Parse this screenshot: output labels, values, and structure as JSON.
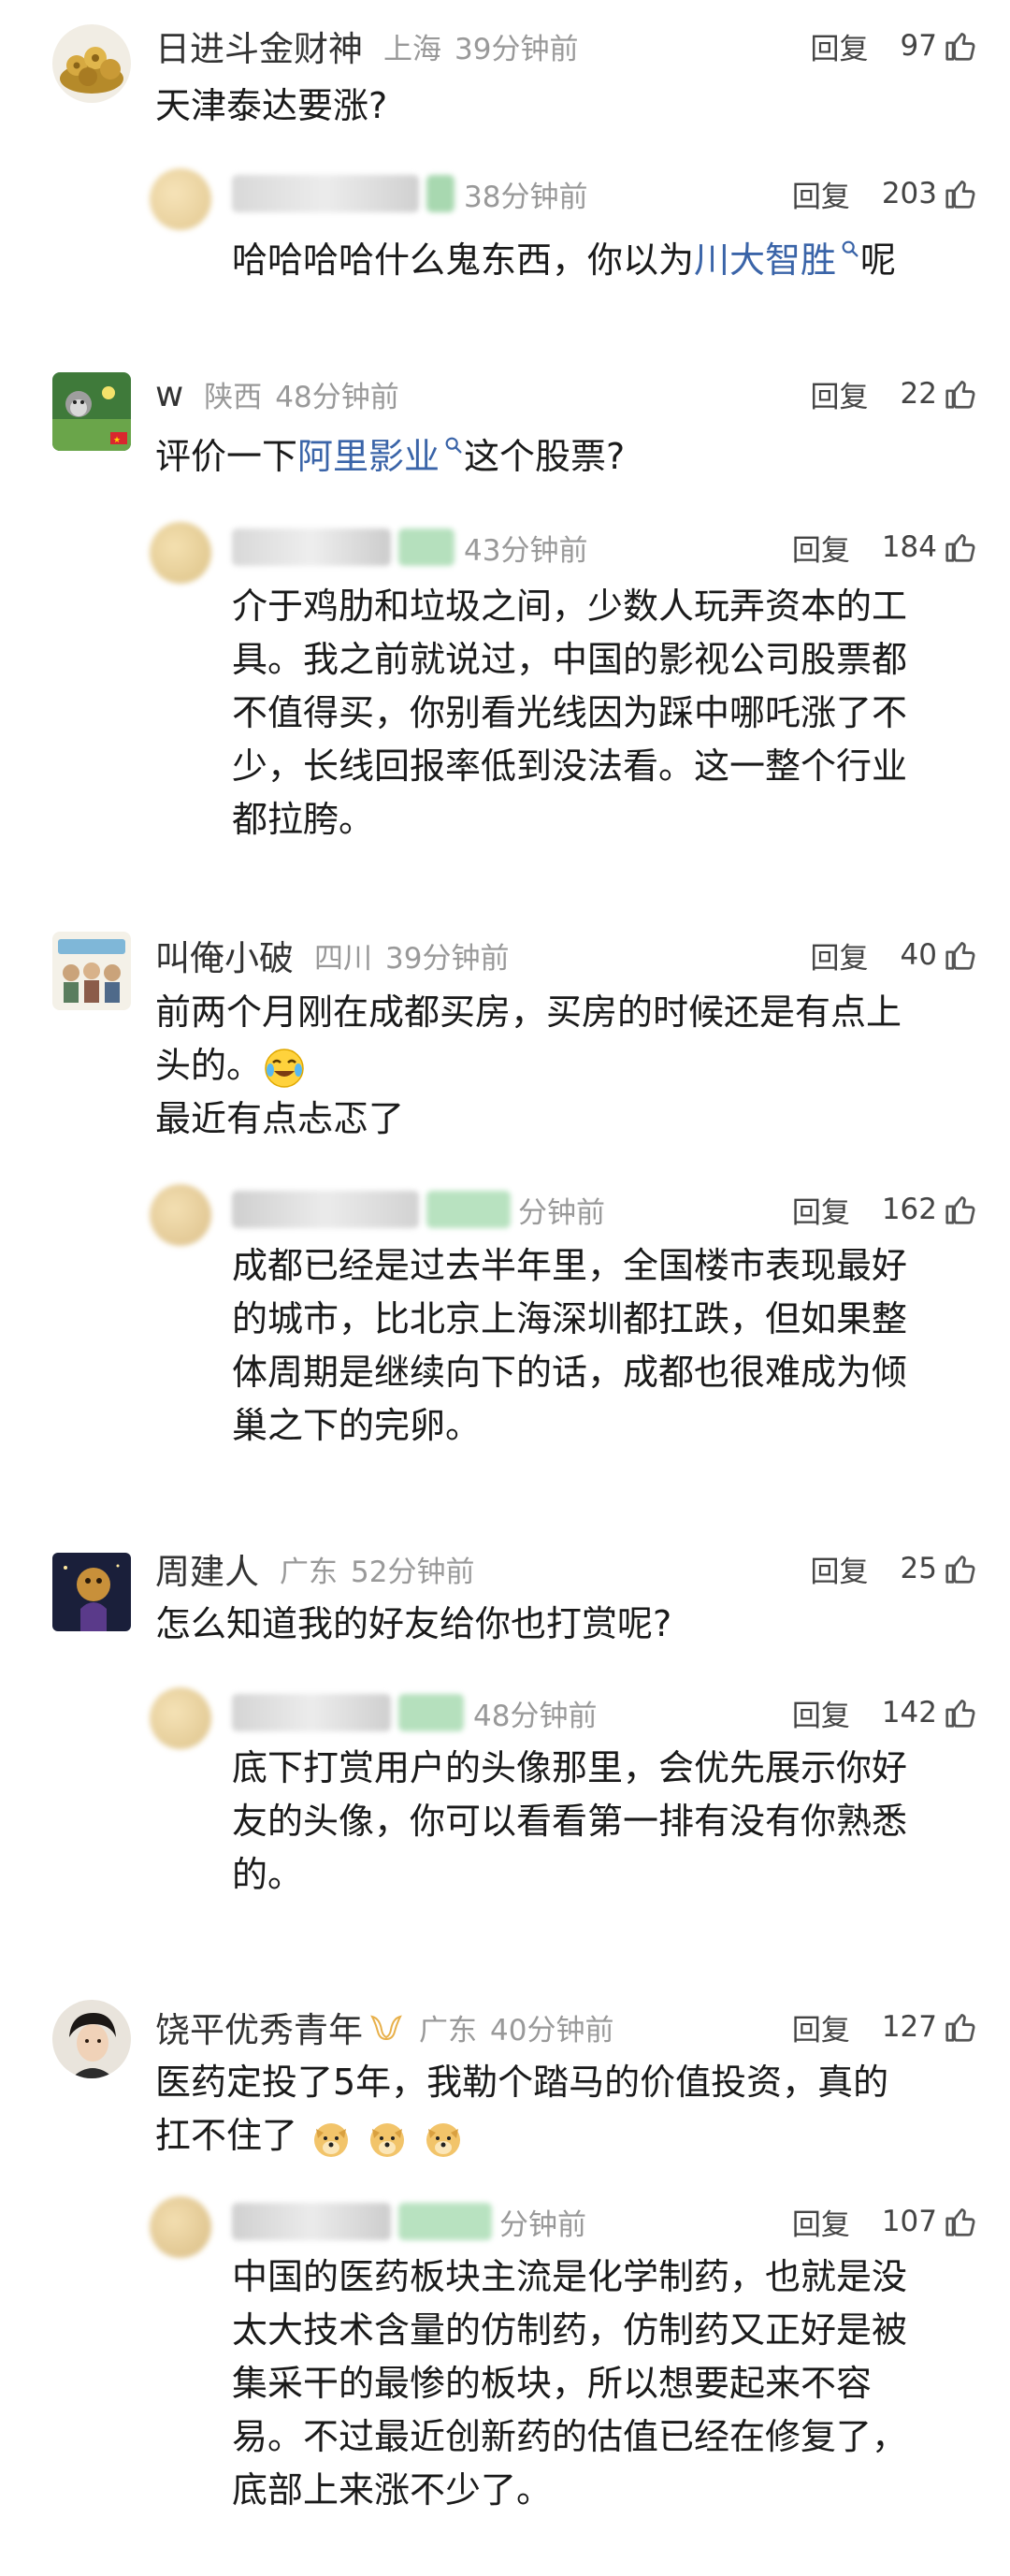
{
  "comments": [
    {
      "username": "日进斗金财神",
      "location": "上海",
      "time": "39分钟前",
      "reply_label": "回复",
      "likes": "97",
      "text": "天津泰达要涨?",
      "reply": {
        "time": "38分钟前",
        "reply_label": "回复",
        "likes": "203",
        "text_before": "哈哈哈哈什么鬼东西，你以为",
        "link": "川大智胜",
        "text_after": "呢"
      }
    },
    {
      "username": "w",
      "location": "陕西",
      "time": "48分钟前",
      "reply_label": "回复",
      "likes": "22",
      "text_before": "评价一下",
      "link": "阿里影业",
      "text_after": "这个股票?",
      "reply": {
        "time": "43分钟前",
        "reply_label": "回复",
        "likes": "184",
        "lines": [
          "介于鸡肋和垃圾之间，少数人玩弄资本的工",
          "具。我之前就说过，中国的影视公司股票都",
          "不值得买，你别看光线因为踩中哪吒涨了不",
          "少，长线回报率低到没法看。这一整个行业",
          "都拉胯。"
        ]
      }
    },
    {
      "username": "叫俺小破",
      "location": "四川",
      "time": "39分钟前",
      "reply_label": "回复",
      "likes": "40",
      "line1": "前两个月刚在成都买房，买房的时候还是有点上",
      "line2": "头的。",
      "line3": "最近有点忐忑了",
      "reply": {
        "time": "分钟前",
        "reply_label": "回复",
        "likes": "162",
        "lines": [
          "成都已经是过去半年里，全国楼市表现最好",
          "的城市，比北京上海深圳都扛跌，但如果整",
          "体周期是继续向下的话，成都也很难成为倾",
          "巢之下的完卵。"
        ]
      }
    },
    {
      "username": "周建人",
      "location": "广东",
      "time": "52分钟前",
      "reply_label": "回复",
      "likes": "25",
      "text": "怎么知道我的好友给你也打赏呢?",
      "reply": {
        "time": "48分钟前",
        "reply_label": "回复",
        "likes": "142",
        "lines": [
          "底下打赏用户的头像那里，会优先展示你好",
          "友的头像，你可以看看第一排有没有你熟悉",
          "的。"
        ]
      }
    },
    {
      "username": "饶平优秀青年",
      "location": "广东",
      "time": "40分钟前",
      "reply_label": "回复",
      "likes": "127",
      "line1": "医药定投了5年，我勒个踏马的价值投资，真的",
      "line2": "扛不住了",
      "reply": {
        "time": "分钟前",
        "reply_label": "回复",
        "likes": "107",
        "lines": [
          "中国的医药板块主流是化学制药，也就是没",
          "太大技术含量的仿制药，仿制药又正好是被",
          "集采干的最惨的板块，所以想要起来不容",
          "易。不过最近创新药的估值已经在修复了，",
          "底部上来涨不少了。"
        ]
      }
    }
  ],
  "colors": {
    "link": "#3a64a8",
    "meta": "#999999",
    "text": "#1a1a1a"
  },
  "icons": [
    "thumb-up-icon",
    "search-mini-icon",
    "laugh-cry-emoji",
    "doge-emoji",
    "vip-badge-icon"
  ]
}
